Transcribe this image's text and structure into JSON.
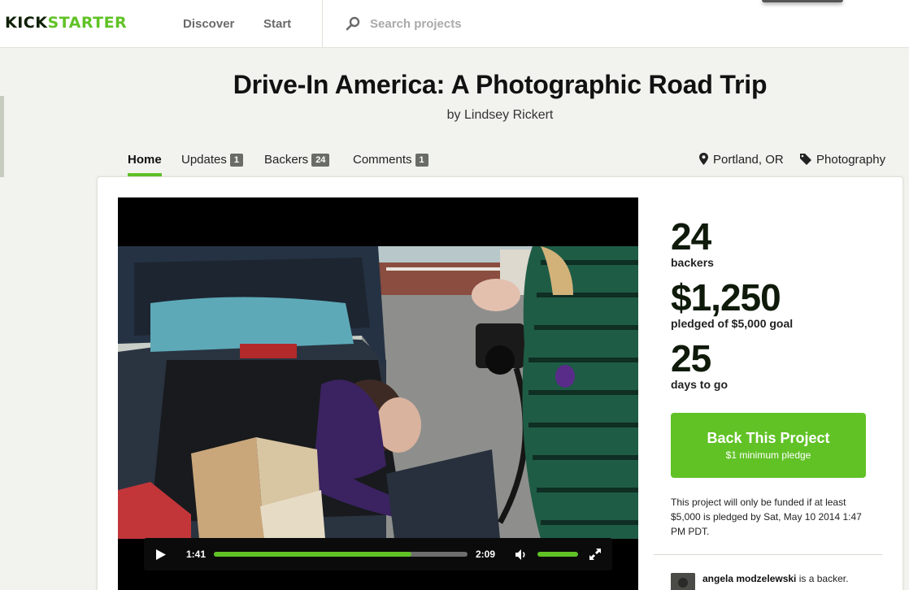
{
  "brand": {
    "kick": "KICK",
    "starter": "STARTER"
  },
  "nav": {
    "discover": "Discover",
    "start": "Start"
  },
  "search": {
    "placeholder": "Search projects"
  },
  "project": {
    "title": "Drive-In America: A Photographic Road Trip",
    "byline": "by Lindsey Rickert"
  },
  "tabs": [
    {
      "label": "Home",
      "count": null
    },
    {
      "label": "Updates",
      "count": "1"
    },
    {
      "label": "Backers",
      "count": "24"
    },
    {
      "label": "Comments",
      "count": "1"
    }
  ],
  "meta": {
    "location": "Portland, OR",
    "category": "Photography"
  },
  "video": {
    "current_time": "1:41",
    "duration": "2:09",
    "progress_fraction": 0.78,
    "volume_fraction": 1.0
  },
  "stats": {
    "backers_value": "24",
    "backers_label": "backers",
    "pledged_value": "$1,250",
    "pledged_label": "pledged of $5,000 goal",
    "days_value": "25",
    "days_label": "days to go"
  },
  "cta": {
    "label": "Back This Project",
    "sub": "$1 minimum pledge"
  },
  "funding_note": "This project will only be funded if at least $5,000 is pledged by Sat, May 10 2014 1:47 PM PDT.",
  "activity": {
    "name": "angela modzelewski",
    "text": " is a backer."
  },
  "colors": {
    "accent": "#61c226",
    "dark": "#0f2105",
    "badge": "#6a6d66"
  }
}
